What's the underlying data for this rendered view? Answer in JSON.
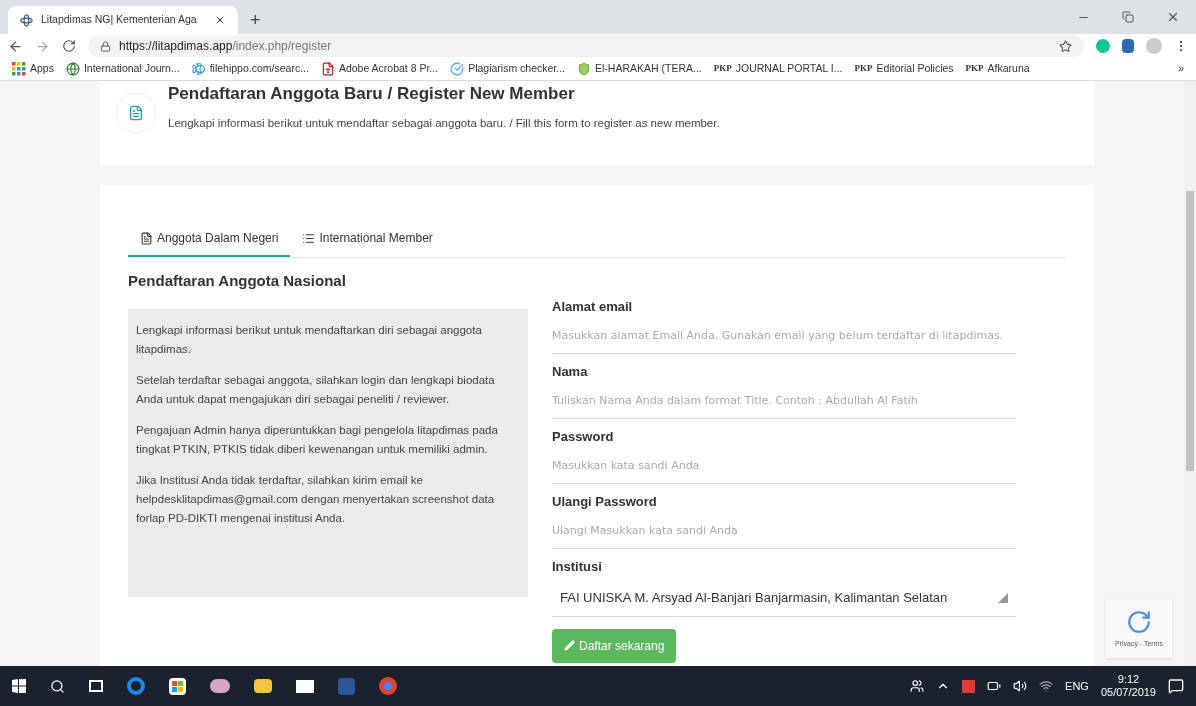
{
  "browser": {
    "tab": {
      "title": "Litapdimas NG| Kementerian Aga",
      "new_tab": "+"
    },
    "url": {
      "domain": "https://litapdimas.app",
      "path": "/index.php/register"
    },
    "bookmarks": [
      {
        "kind": "apps",
        "label": "Apps"
      },
      {
        "kind": "globe",
        "label": "International Journ..."
      },
      {
        "kind": "fish",
        "label": "filehippo.com/searc..."
      },
      {
        "kind": "acrobat",
        "label": "Adobe Acrobat 8 Pr..."
      },
      {
        "kind": "check",
        "label": "Plagiarism checker..."
      },
      {
        "kind": "shield",
        "label": "El-HARAKAH (TERA..."
      },
      {
        "kind": "pkp",
        "prefix": "PKP",
        "label": "JOURNAL PORTAL I..."
      },
      {
        "kind": "pkp",
        "prefix": "PKP",
        "label": "Editorial Policies"
      },
      {
        "kind": "pkp",
        "prefix": "PKP",
        "label": "Afkaruna"
      }
    ],
    "more": "»"
  },
  "header": {
    "title": "Pendaftaran Anggota Baru / Register New Member",
    "subtitle": "Lengkapi informasi berikut untuk mendaftar sebagai anggota baru. / Fill this form to register as new member."
  },
  "tabs": [
    {
      "kind": "file",
      "label": "Anggota Dalam Negeri",
      "selected": true
    },
    {
      "kind": "list",
      "label": "International Member",
      "selected": false
    }
  ],
  "section_title": "Pendaftaran Anggota Nasional",
  "info": [
    "Lengkapi informasi berikut untuk mendaftarkan diri sebagai anggota litapdimas.",
    "Setelah terdaftar sebagai anggota, silahkan login dan lengkapi biodata Anda untuk dapat mengajukan diri sebagai peneliti / reviewer.",
    "Pengajuan Admin hanya diperuntukkan bagi pengelola litapdimas pada tingkat PTKIN, PTKIS tidak diberi kewenangan untuk memiliki admin.",
    "Jika Institusi Anda tidak terdaftar, silahkan kirim email ke helpdesklitapdimas@gmail.com dengan menyertakan screenshot data forlap PD-DIKTI mengenai institusi Anda."
  ],
  "fields": [
    {
      "kind": "text",
      "label": "Alamat email",
      "placeholder": "Masukkan alamat Email Anda. Gunakan email yang belum terdaftar di litapdimas."
    },
    {
      "kind": "text",
      "label": "Nama",
      "placeholder": "Tuliskan Nama Anda dalam format Title. Contoh : Abdullah Al Fatih"
    },
    {
      "kind": "password",
      "label": "Password",
      "placeholder": "Masukkan kata sandi Anda"
    },
    {
      "kind": "password",
      "label": "Ulangi Password",
      "placeholder": "Ulangi Masukkan kata sandi Anda"
    },
    {
      "kind": "select",
      "label": "Institusi",
      "value": "FAI UNISKA M. Arsyad Al-Banjari Banjarmasin, Kalimantan Selatan"
    }
  ],
  "submit": "Daftar sekarang",
  "recaptcha": "Privacy - Terms",
  "taskbar": {
    "language": "ENG",
    "time": "9:12",
    "date": "05/07/2019"
  }
}
